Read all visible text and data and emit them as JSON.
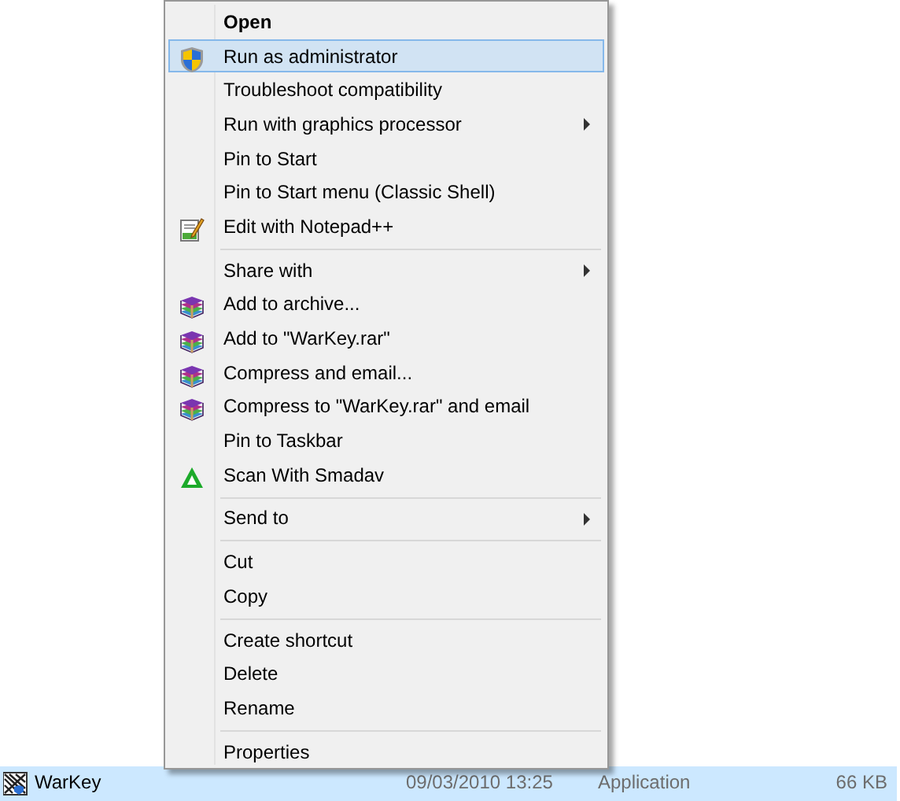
{
  "file_row": {
    "name": "WarKey",
    "date": "09/03/2010 13:25",
    "type": "Application",
    "size": "66 KB",
    "selected": true
  },
  "context_menu": {
    "groups": [
      {
        "items": [
          {
            "label": "Open",
            "default": true,
            "selected": false,
            "submenu": false
          },
          {
            "label": "Run as administrator",
            "kind": "shield",
            "selected": true,
            "submenu": false
          },
          {
            "label": "Troubleshoot compatibility",
            "selected": false,
            "submenu": false
          },
          {
            "label": "Run with graphics processor",
            "selected": false,
            "submenu": true
          },
          {
            "label": "Pin to Start",
            "selected": false,
            "submenu": false
          },
          {
            "label": "Pin to Start menu (Classic Shell)",
            "selected": false,
            "submenu": false
          },
          {
            "label": "Edit with Notepad++",
            "kind": "notepad",
            "selected": false,
            "submenu": false
          }
        ]
      },
      {
        "items": [
          {
            "label": "Share with",
            "selected": false,
            "submenu": true
          },
          {
            "label": "Add to archive...",
            "kind": "archive",
            "selected": false,
            "submenu": false
          },
          {
            "label": "Add to \"WarKey.rar\"",
            "kind": "archive",
            "selected": false,
            "submenu": false
          },
          {
            "label": "Compress and email...",
            "kind": "archive",
            "selected": false,
            "submenu": false
          },
          {
            "label": "Compress to \"WarKey.rar\" and email",
            "kind": "archive",
            "selected": false,
            "submenu": false
          },
          {
            "label": "Pin to Taskbar",
            "selected": false,
            "submenu": false
          },
          {
            "label": "Scan With Smadav",
            "kind": "triangle",
            "selected": false,
            "submenu": false
          }
        ]
      },
      {
        "items": [
          {
            "label": "Send to",
            "selected": false,
            "submenu": true
          }
        ]
      },
      {
        "items": [
          {
            "label": "Cut",
            "selected": false,
            "submenu": false
          },
          {
            "label": "Copy",
            "selected": false,
            "submenu": false
          }
        ]
      },
      {
        "items": [
          {
            "label": "Create shortcut",
            "selected": false,
            "submenu": false
          },
          {
            "label": "Delete",
            "selected": false,
            "submenu": false
          },
          {
            "label": "Rename",
            "selected": false,
            "submenu": false
          }
        ]
      },
      {
        "items": [
          {
            "label": "Properties",
            "selected": false,
            "submenu": false
          }
        ]
      }
    ]
  }
}
